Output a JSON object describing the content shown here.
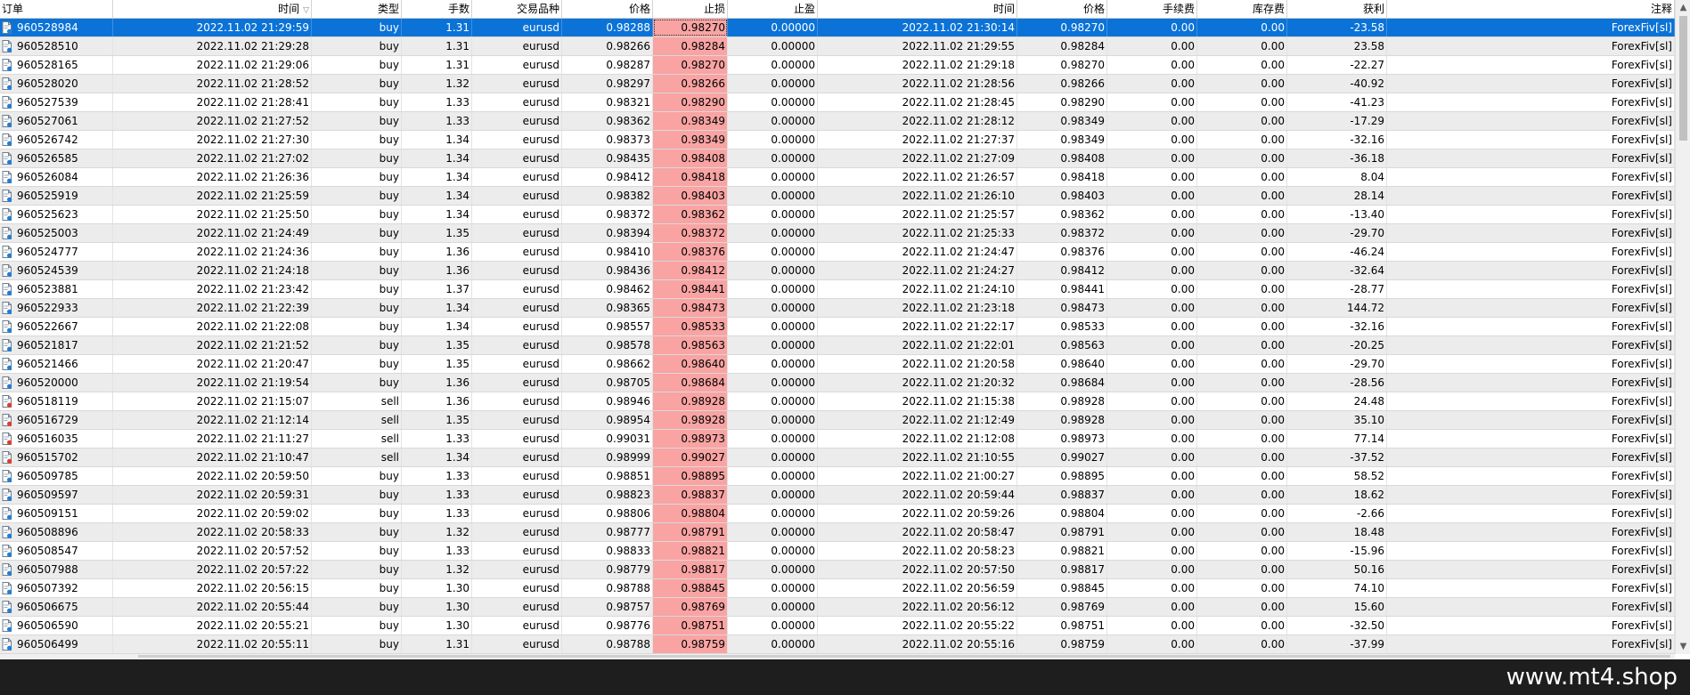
{
  "columns": [
    "订单",
    "时间",
    "类型",
    "手数",
    "交易品种",
    "价格",
    "止损",
    "止盈",
    "时间",
    "价格",
    "手续费",
    "库存费",
    "获利",
    "注释"
  ],
  "sort_indicator": "▽",
  "colors": {
    "selected_row": "#0b73d7",
    "stop_loss_cell": "#f9a3a3",
    "odd_row": "#ececec"
  },
  "rows": [
    [
      "960528984",
      "2022.11.02 21:29:59",
      "buy",
      "1.31",
      "eurusd",
      "0.98288",
      "0.98270",
      "0.00000",
      "2022.11.02 21:30:14",
      "0.98270",
      "0.00",
      "0.00",
      "-23.58",
      "ForexFiv[sl]"
    ],
    [
      "960528510",
      "2022.11.02 21:29:28",
      "buy",
      "1.31",
      "eurusd",
      "0.98266",
      "0.98284",
      "0.00000",
      "2022.11.02 21:29:55",
      "0.98284",
      "0.00",
      "0.00",
      "23.58",
      "ForexFiv[sl]"
    ],
    [
      "960528165",
      "2022.11.02 21:29:06",
      "buy",
      "1.31",
      "eurusd",
      "0.98287",
      "0.98270",
      "0.00000",
      "2022.11.02 21:29:18",
      "0.98270",
      "0.00",
      "0.00",
      "-22.27",
      "ForexFiv[sl]"
    ],
    [
      "960528020",
      "2022.11.02 21:28:52",
      "buy",
      "1.32",
      "eurusd",
      "0.98297",
      "0.98266",
      "0.00000",
      "2022.11.02 21:28:56",
      "0.98266",
      "0.00",
      "0.00",
      "-40.92",
      "ForexFiv[sl]"
    ],
    [
      "960527539",
      "2022.11.02 21:28:41",
      "buy",
      "1.33",
      "eurusd",
      "0.98321",
      "0.98290",
      "0.00000",
      "2022.11.02 21:28:45",
      "0.98290",
      "0.00",
      "0.00",
      "-41.23",
      "ForexFiv[sl]"
    ],
    [
      "960527061",
      "2022.11.02 21:27:52",
      "buy",
      "1.33",
      "eurusd",
      "0.98362",
      "0.98349",
      "0.00000",
      "2022.11.02 21:28:12",
      "0.98349",
      "0.00",
      "0.00",
      "-17.29",
      "ForexFiv[sl]"
    ],
    [
      "960526742",
      "2022.11.02 21:27:30",
      "buy",
      "1.34",
      "eurusd",
      "0.98373",
      "0.98349",
      "0.00000",
      "2022.11.02 21:27:37",
      "0.98349",
      "0.00",
      "0.00",
      "-32.16",
      "ForexFiv[sl]"
    ],
    [
      "960526585",
      "2022.11.02 21:27:02",
      "buy",
      "1.34",
      "eurusd",
      "0.98435",
      "0.98408",
      "0.00000",
      "2022.11.02 21:27:09",
      "0.98408",
      "0.00",
      "0.00",
      "-36.18",
      "ForexFiv[sl]"
    ],
    [
      "960526084",
      "2022.11.02 21:26:36",
      "buy",
      "1.34",
      "eurusd",
      "0.98412",
      "0.98418",
      "0.00000",
      "2022.11.02 21:26:57",
      "0.98418",
      "0.00",
      "0.00",
      "8.04",
      "ForexFiv[sl]"
    ],
    [
      "960525919",
      "2022.11.02 21:25:59",
      "buy",
      "1.34",
      "eurusd",
      "0.98382",
      "0.98403",
      "0.00000",
      "2022.11.02 21:26:10",
      "0.98403",
      "0.00",
      "0.00",
      "28.14",
      "ForexFiv[sl]"
    ],
    [
      "960525623",
      "2022.11.02 21:25:50",
      "buy",
      "1.34",
      "eurusd",
      "0.98372",
      "0.98362",
      "0.00000",
      "2022.11.02 21:25:57",
      "0.98362",
      "0.00",
      "0.00",
      "-13.40",
      "ForexFiv[sl]"
    ],
    [
      "960525003",
      "2022.11.02 21:24:49",
      "buy",
      "1.35",
      "eurusd",
      "0.98394",
      "0.98372",
      "0.00000",
      "2022.11.02 21:25:33",
      "0.98372",
      "0.00",
      "0.00",
      "-29.70",
      "ForexFiv[sl]"
    ],
    [
      "960524777",
      "2022.11.02 21:24:36",
      "buy",
      "1.36",
      "eurusd",
      "0.98410",
      "0.98376",
      "0.00000",
      "2022.11.02 21:24:47",
      "0.98376",
      "0.00",
      "0.00",
      "-46.24",
      "ForexFiv[sl]"
    ],
    [
      "960524539",
      "2022.11.02 21:24:18",
      "buy",
      "1.36",
      "eurusd",
      "0.98436",
      "0.98412",
      "0.00000",
      "2022.11.02 21:24:27",
      "0.98412",
      "0.00",
      "0.00",
      "-32.64",
      "ForexFiv[sl]"
    ],
    [
      "960523881",
      "2022.11.02 21:23:42",
      "buy",
      "1.37",
      "eurusd",
      "0.98462",
      "0.98441",
      "0.00000",
      "2022.11.02 21:24:10",
      "0.98441",
      "0.00",
      "0.00",
      "-28.77",
      "ForexFiv[sl]"
    ],
    [
      "960522933",
      "2022.11.02 21:22:39",
      "buy",
      "1.34",
      "eurusd",
      "0.98365",
      "0.98473",
      "0.00000",
      "2022.11.02 21:23:18",
      "0.98473",
      "0.00",
      "0.00",
      "144.72",
      "ForexFiv[sl]"
    ],
    [
      "960522667",
      "2022.11.02 21:22:08",
      "buy",
      "1.34",
      "eurusd",
      "0.98557",
      "0.98533",
      "0.00000",
      "2022.11.02 21:22:17",
      "0.98533",
      "0.00",
      "0.00",
      "-32.16",
      "ForexFiv[sl]"
    ],
    [
      "960521817",
      "2022.11.02 21:21:52",
      "buy",
      "1.35",
      "eurusd",
      "0.98578",
      "0.98563",
      "0.00000",
      "2022.11.02 21:22:01",
      "0.98563",
      "0.00",
      "0.00",
      "-20.25",
      "ForexFiv[sl]"
    ],
    [
      "960521466",
      "2022.11.02 21:20:47",
      "buy",
      "1.35",
      "eurusd",
      "0.98662",
      "0.98640",
      "0.00000",
      "2022.11.02 21:20:58",
      "0.98640",
      "0.00",
      "0.00",
      "-29.70",
      "ForexFiv[sl]"
    ],
    [
      "960520000",
      "2022.11.02 21:19:54",
      "buy",
      "1.36",
      "eurusd",
      "0.98705",
      "0.98684",
      "0.00000",
      "2022.11.02 21:20:32",
      "0.98684",
      "0.00",
      "0.00",
      "-28.56",
      "ForexFiv[sl]"
    ],
    [
      "960518119",
      "2022.11.02 21:15:07",
      "sell",
      "1.36",
      "eurusd",
      "0.98946",
      "0.98928",
      "0.00000",
      "2022.11.02 21:15:38",
      "0.98928",
      "0.00",
      "0.00",
      "24.48",
      "ForexFiv[sl]"
    ],
    [
      "960516729",
      "2022.11.02 21:12:14",
      "sell",
      "1.35",
      "eurusd",
      "0.98954",
      "0.98928",
      "0.00000",
      "2022.11.02 21:12:49",
      "0.98928",
      "0.00",
      "0.00",
      "35.10",
      "ForexFiv[sl]"
    ],
    [
      "960516035",
      "2022.11.02 21:11:27",
      "sell",
      "1.33",
      "eurusd",
      "0.99031",
      "0.98973",
      "0.00000",
      "2022.11.02 21:12:08",
      "0.98973",
      "0.00",
      "0.00",
      "77.14",
      "ForexFiv[sl]"
    ],
    [
      "960515702",
      "2022.11.02 21:10:47",
      "sell",
      "1.34",
      "eurusd",
      "0.98999",
      "0.99027",
      "0.00000",
      "2022.11.02 21:10:55",
      "0.99027",
      "0.00",
      "0.00",
      "-37.52",
      "ForexFiv[sl]"
    ],
    [
      "960509785",
      "2022.11.02 20:59:50",
      "buy",
      "1.33",
      "eurusd",
      "0.98851",
      "0.98895",
      "0.00000",
      "2022.11.02 21:00:27",
      "0.98895",
      "0.00",
      "0.00",
      "58.52",
      "ForexFiv[sl]"
    ],
    [
      "960509597",
      "2022.11.02 20:59:31",
      "buy",
      "1.33",
      "eurusd",
      "0.98823",
      "0.98837",
      "0.00000",
      "2022.11.02 20:59:44",
      "0.98837",
      "0.00",
      "0.00",
      "18.62",
      "ForexFiv[sl]"
    ],
    [
      "960509151",
      "2022.11.02 20:59:02",
      "buy",
      "1.33",
      "eurusd",
      "0.98806",
      "0.98804",
      "0.00000",
      "2022.11.02 20:59:26",
      "0.98804",
      "0.00",
      "0.00",
      "-2.66",
      "ForexFiv[sl]"
    ],
    [
      "960508896",
      "2022.11.02 20:58:33",
      "buy",
      "1.32",
      "eurusd",
      "0.98777",
      "0.98791",
      "0.00000",
      "2022.11.02 20:58:47",
      "0.98791",
      "0.00",
      "0.00",
      "18.48",
      "ForexFiv[sl]"
    ],
    [
      "960508547",
      "2022.11.02 20:57:52",
      "buy",
      "1.33",
      "eurusd",
      "0.98833",
      "0.98821",
      "0.00000",
      "2022.11.02 20:58:23",
      "0.98821",
      "0.00",
      "0.00",
      "-15.96",
      "ForexFiv[sl]"
    ],
    [
      "960507988",
      "2022.11.02 20:57:22",
      "buy",
      "1.32",
      "eurusd",
      "0.98779",
      "0.98817",
      "0.00000",
      "2022.11.02 20:57:50",
      "0.98817",
      "0.00",
      "0.00",
      "50.16",
      "ForexFiv[sl]"
    ],
    [
      "960507392",
      "2022.11.02 20:56:15",
      "buy",
      "1.30",
      "eurusd",
      "0.98788",
      "0.98845",
      "0.00000",
      "2022.11.02 20:56:59",
      "0.98845",
      "0.00",
      "0.00",
      "74.10",
      "ForexFiv[sl]"
    ],
    [
      "960506675",
      "2022.11.02 20:55:44",
      "buy",
      "1.30",
      "eurusd",
      "0.98757",
      "0.98769",
      "0.00000",
      "2022.11.02 20:56:12",
      "0.98769",
      "0.00",
      "0.00",
      "15.60",
      "ForexFiv[sl]"
    ],
    [
      "960506590",
      "2022.11.02 20:55:21",
      "buy",
      "1.30",
      "eurusd",
      "0.98776",
      "0.98751",
      "0.00000",
      "2022.11.02 20:55:22",
      "0.98751",
      "0.00",
      "0.00",
      "-32.50",
      "ForexFiv[sl]"
    ],
    [
      "960506499",
      "2022.11.02 20:55:11",
      "buy",
      "1.31",
      "eurusd",
      "0.98788",
      "0.98759",
      "0.00000",
      "2022.11.02 20:55:16",
      "0.98759",
      "0.00",
      "0.00",
      "-37.99",
      "ForexFiv[sl]"
    ]
  ],
  "selected_row_index": 0,
  "scrollbar": {
    "up_glyph": "▲",
    "down_glyph": "▼"
  },
  "watermark": "www.mt4.shop"
}
